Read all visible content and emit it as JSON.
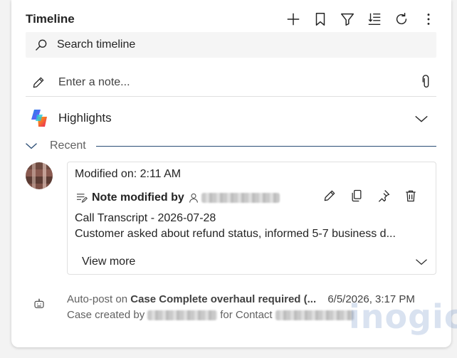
{
  "timeline": {
    "title": "Timeline",
    "toolbar": {
      "icons": [
        "plus-icon",
        "bookmark-icon",
        "filter-icon",
        "sort-icon",
        "refresh-icon",
        "more-icon"
      ]
    },
    "search": {
      "placeholder": "Search timeline"
    },
    "note": {
      "placeholder": "Enter a note..."
    },
    "highlights": {
      "label": "Highlights"
    },
    "recent": {
      "label": "Recent"
    },
    "post": {
      "modified": "Modified on: 2:11 AM",
      "title_prefix": "Note modified by",
      "subject": "Call Transcript - 2026-07-28",
      "body": "Customer asked about refund status, informed 5-7 business d...",
      "view_more": "View more"
    },
    "autopost": {
      "prefix": "Auto-post on",
      "case": "Case Complete overhaul required (...",
      "date": "6/5/2026, 3:17 PM",
      "created_prefix": "Case created by",
      "for_contact": "for Contact"
    },
    "watermark": "inogic"
  },
  "colors": {
    "accent": "#2b4d75",
    "card": "#ffffff",
    "search_bg": "#f5f5f5",
    "text": "#242424",
    "muted": "#616161"
  }
}
